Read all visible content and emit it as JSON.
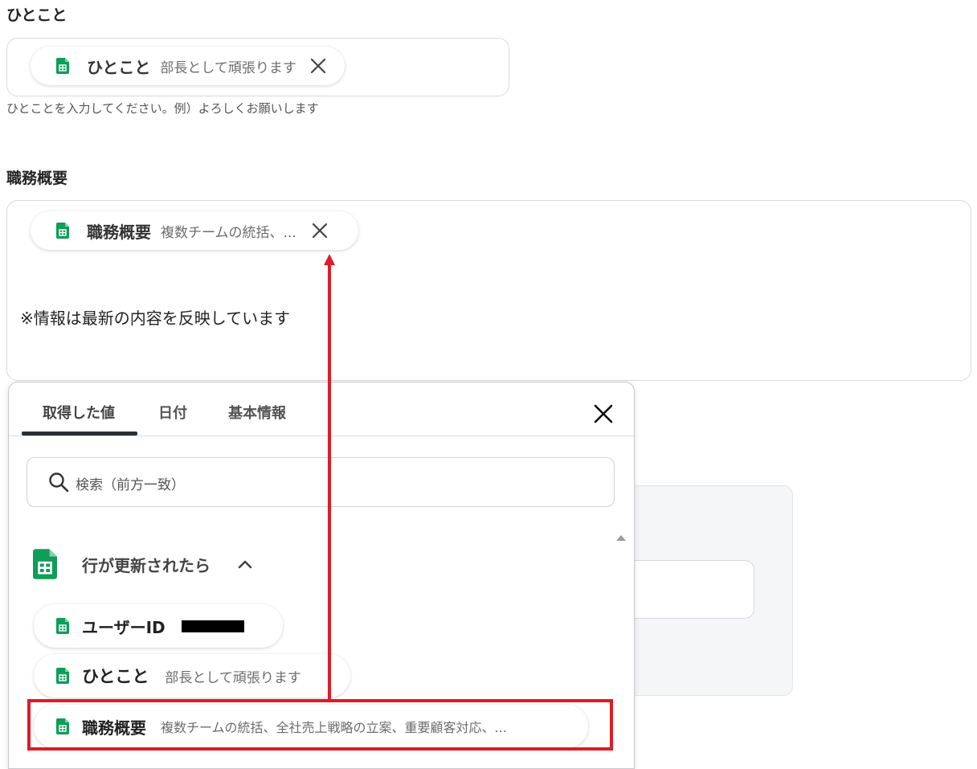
{
  "hitokoto_section": {
    "title": "ひとこと",
    "chip": {
      "label": "ひとこと",
      "value": "部長として頑張ります"
    },
    "hint": "ひとことを入力してください。例）よろしくお願いします"
  },
  "duties_section": {
    "title": "職務概要",
    "chip": {
      "label": "職務概要",
      "value": "複数チームの統括、..."
    },
    "body_text": "※情報は最新の内容を反映しています"
  },
  "dropdown": {
    "tabs": [
      {
        "label": "取得した値",
        "active": true
      },
      {
        "label": "日付",
        "active": false
      },
      {
        "label": "基本情報",
        "active": false
      }
    ],
    "search": {
      "placeholder": "検索（前方一致）",
      "value": ""
    },
    "group": {
      "label": "行が更新されたら",
      "expanded": true
    },
    "items": [
      {
        "label": "ユーザーID",
        "value": ""
      },
      {
        "label": "ひとこと",
        "value": "部長として頑張ります"
      },
      {
        "label": "職務概要",
        "value": "複数チームの統括、全社売上戦略の立案、重要顧客対応、..."
      }
    ]
  },
  "colors": {
    "sheets_green": "#0f9d58",
    "highlight_red": "#e01b24",
    "active_tab_underline": "#2b2f36"
  },
  "icons": {
    "sheet": "google-sheets-icon",
    "close": "close-icon",
    "search": "search-icon",
    "chevron": "chevron-up-icon"
  }
}
